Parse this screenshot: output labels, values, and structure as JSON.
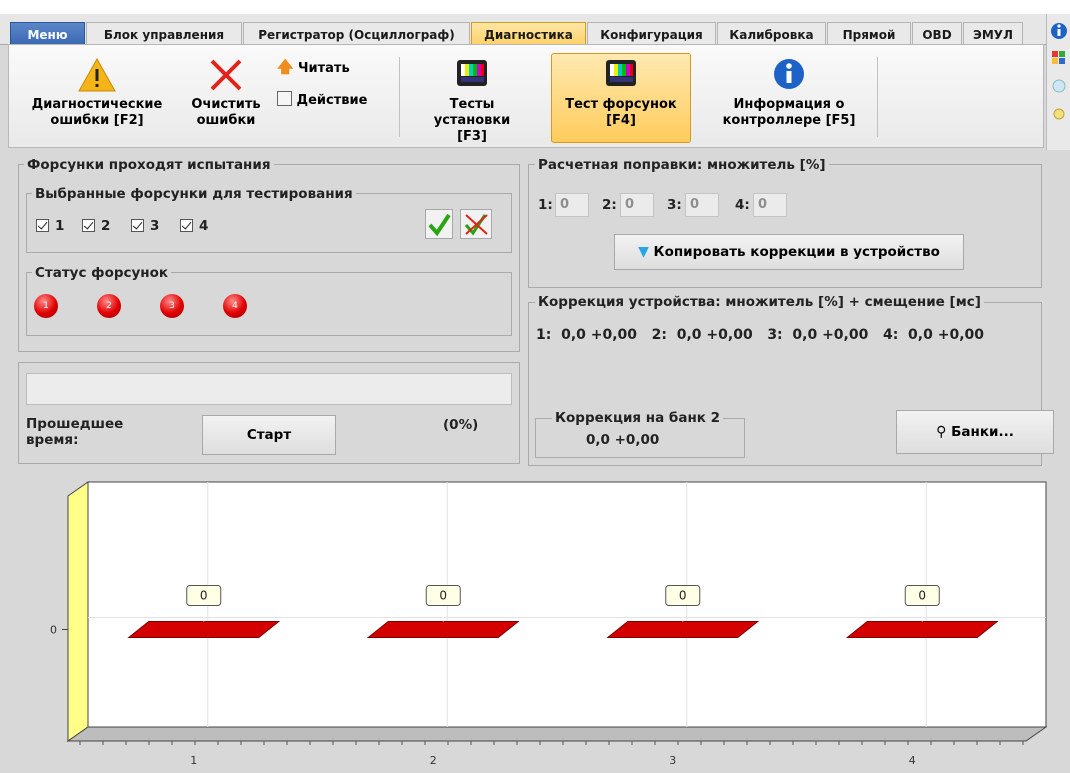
{
  "tabs": [
    {
      "label": "Меню",
      "kind": "menu"
    },
    {
      "label": "Блок управления",
      "kind": "normal"
    },
    {
      "label": "Регистратор (Осциллограф)",
      "kind": "normal"
    },
    {
      "label": "Диагностика",
      "kind": "active"
    },
    {
      "label": "Конфигурация",
      "kind": "normal"
    },
    {
      "label": "Калибровка",
      "kind": "normal"
    },
    {
      "label": "Прямой",
      "kind": "normal"
    },
    {
      "label": "OBD",
      "kind": "normal"
    },
    {
      "label": "ЭМУЛ",
      "kind": "normal"
    }
  ],
  "ribbon": {
    "diag_errors": "Диагностические ошибки [F2]",
    "clear_errors": "Очистить ошибки",
    "read": "Читать",
    "action": "Действие",
    "install_tests": "Тесты установки [F3]",
    "injector_test": "Тест форсунок [F4]",
    "controller_info": "Информация о контроллере [F5]"
  },
  "injectors_panel": {
    "title": "Форсунки проходят испытания",
    "selected_title": "Выбранные форсунки для тестирования",
    "checkboxes": [
      "1",
      "2",
      "3",
      "4"
    ],
    "status_title": "Статус форсунок",
    "leds": [
      "1",
      "2",
      "3",
      "4"
    ]
  },
  "calc_panel": {
    "title": "Расчетная поправки: множитель [%]",
    "fields": [
      {
        "label": "1:",
        "value": "0"
      },
      {
        "label": "2:",
        "value": "0"
      },
      {
        "label": "3:",
        "value": "0"
      },
      {
        "label": "4:",
        "value": "0"
      }
    ],
    "copy_button": "Копировать коррекции в устройство"
  },
  "device_panel": {
    "title": "Коррекция устройства: множитель [%] + смещение [мс]",
    "values": "1:  0,0 +0,00   2:  0,0 +0,00   3:  0,0 +0,00   4:  0,0 +0,00",
    "bank2_title": "Коррекция на банк 2",
    "bank2_value": "0,0 +0,00",
    "banks_button": "Банки..."
  },
  "progress": {
    "elapsed_label": "Прошедшее время:",
    "start_button": "Старт",
    "percent": "(0%)",
    "fraction": 0
  },
  "chart_data": {
    "type": "bar",
    "categories": [
      "1",
      "2",
      "3",
      "4"
    ],
    "values": [
      0,
      0,
      0,
      0
    ],
    "data_labels": [
      "0",
      "0",
      "0",
      "0"
    ],
    "yticks": [
      "0"
    ],
    "bar_color": "#d40000",
    "grid": true
  },
  "colors": {
    "accent_active": "#ffca58",
    "menu_tab": "#3261ad",
    "led_red": "#e00000"
  }
}
